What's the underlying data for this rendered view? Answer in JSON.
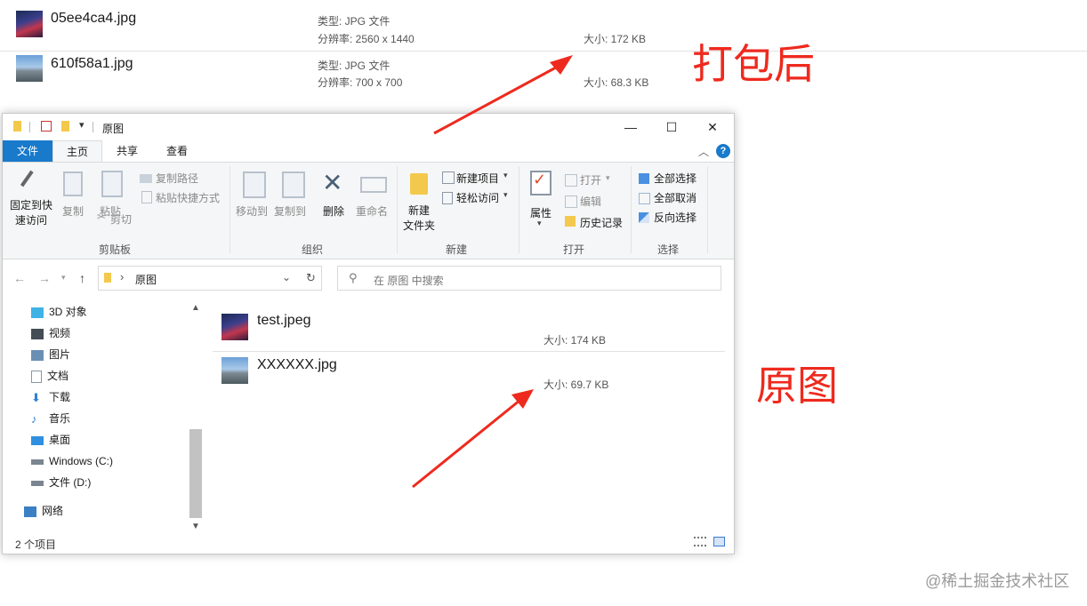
{
  "top_files": [
    {
      "name": "05ee4ca4.jpg",
      "type": "类型: JPG 文件",
      "dims": "分辨率: 2560 x 1440",
      "size": "大小: 172 KB",
      "thumb": "night"
    },
    {
      "name": "610f58a1.jpg",
      "type": "类型: JPG 文件",
      "dims": "分辨率: 700 x 700",
      "size": "大小: 68.3 KB",
      "thumb": "day"
    }
  ],
  "annotations": {
    "after": "打包后",
    "original": "原图",
    "arrow_color": "#ee2a1e"
  },
  "window": {
    "title": "原图",
    "controls": {
      "minimize": "—",
      "maximize": "☐",
      "close": "✕"
    },
    "tabs": [
      "文件",
      "主页",
      "共享",
      "查看"
    ],
    "help": "?",
    "ribbon": {
      "pin": "固定到快\n速访问",
      "copy": "复制",
      "paste": "粘贴",
      "copy_path": "复制路径",
      "paste_shortcut": "粘贴快捷方式",
      "cut": "剪切",
      "group_clipboard": "剪贴板",
      "move_to": "移动到",
      "copy_to": "复制到",
      "delete": "删除",
      "rename": "重命名",
      "group_organize": "组织",
      "new_folder": "新建\n文件夹",
      "new_item": "新建项目",
      "easy_access": "轻松访问",
      "group_new": "新建",
      "properties": "属性",
      "open": "打开",
      "edit": "编辑",
      "history": "历史记录",
      "group_open": "打开",
      "select_all": "全部选择",
      "select_none": "全部取消",
      "invert": "反向选择",
      "group_select": "选择"
    },
    "address": {
      "path": "原图",
      "separator": "›"
    },
    "search_placeholder": "在 原图 中搜索",
    "tree": [
      {
        "label": "3D 对象",
        "icon": "3d-objects-icon",
        "color": "#3fb3e6"
      },
      {
        "label": "视频",
        "icon": "video-icon",
        "color": "#444c55"
      },
      {
        "label": "图片",
        "icon": "pictures-icon",
        "color": "#6a8fb5"
      },
      {
        "label": "文档",
        "icon": "documents-icon",
        "color": "#8a97a5"
      },
      {
        "label": "下载",
        "icon": "downloads-icon",
        "color": "#2f7fd8"
      },
      {
        "label": "音乐",
        "icon": "music-icon",
        "color": "#2f7fd8"
      },
      {
        "label": "桌面",
        "icon": "desktop-icon",
        "color": "#2f8fe0"
      },
      {
        "label": "Windows (C:)",
        "icon": "drive-c-icon",
        "color": "#7a8590"
      },
      {
        "label": "文件 (D:)",
        "icon": "drive-d-icon",
        "color": "#7a8590"
      },
      {
        "label": "网络",
        "icon": "network-icon",
        "color": "#3b7fc4"
      }
    ],
    "files": [
      {
        "name": "test.jpeg",
        "size": "大小: 174 KB",
        "thumb": "night"
      },
      {
        "name": "XXXXXX.jpg",
        "size": "大小: 69.7 KB",
        "thumb": "day"
      }
    ],
    "status": "2 个项目"
  },
  "watermark": "@稀土掘金技术社区"
}
